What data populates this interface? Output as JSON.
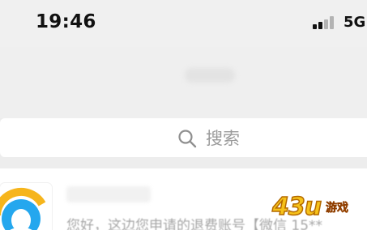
{
  "status_bar": {
    "time": "19:46",
    "network": "5G"
  },
  "search": {
    "label": "搜索"
  },
  "chat": {
    "preview": "您好，这边您申请的退费账号【微信 15**"
  },
  "watermark": {
    "digits": "43u",
    "text": "游戏"
  },
  "colors": {
    "background": "#ededed",
    "search_text": "#9a9a9a",
    "preview_text": "#a7a7a7",
    "watermark_yellow": "#f6c21a",
    "watermark_orange": "#e06d00"
  }
}
